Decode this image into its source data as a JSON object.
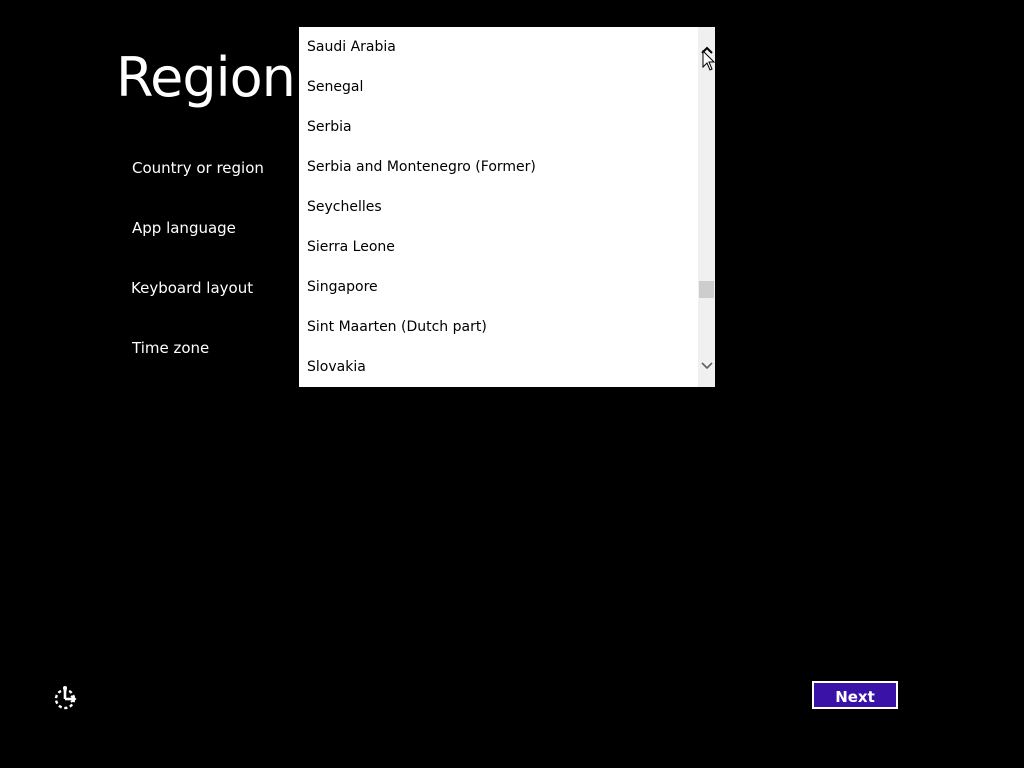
{
  "page": {
    "title": "Region"
  },
  "settings": {
    "country_label": "Country or region",
    "app_language_label": "App language",
    "keyboard_label": "Keyboard layout",
    "timezone_label": "Time zone"
  },
  "country_dropdown": {
    "items": [
      "Saudi Arabia",
      "Senegal",
      "Serbia",
      "Serbia and Montenegro (Former)",
      "Seychelles",
      "Sierra Leone",
      "Singapore",
      "Sint Maarten (Dutch part)",
      "Slovakia"
    ]
  },
  "buttons": {
    "next_label": "Next"
  },
  "colors": {
    "background": "#000000",
    "accent": "#3b12a8",
    "dropdown_background": "#ffffff",
    "text_light": "#ffffff",
    "text_dark": "#000000"
  },
  "icons": {
    "ease_of_access": "ease-of-access-icon",
    "scroll_up": "chevron-up-icon",
    "scroll_down": "chevron-down-icon",
    "cursor": "mouse-pointer-icon"
  }
}
